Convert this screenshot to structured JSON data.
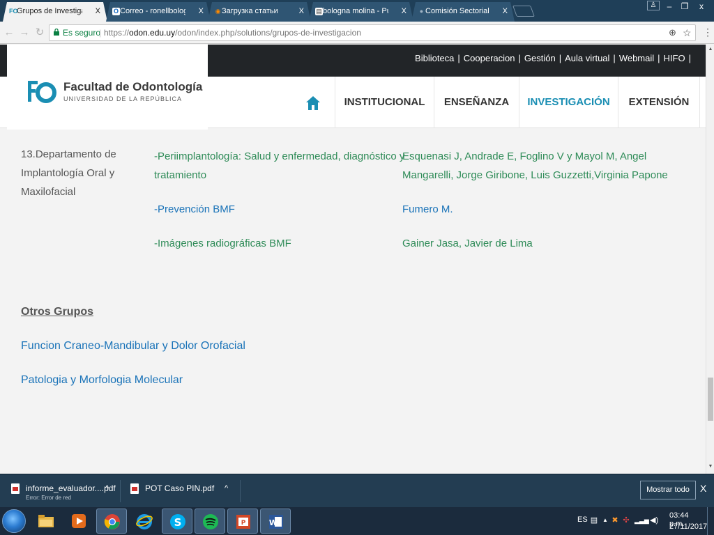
{
  "browser": {
    "tabs": [
      {
        "title": "Grupos de Investigación",
        "icon": "fo-favicon",
        "active": true
      },
      {
        "title": "Correo - ronellbologna@",
        "icon": "outlook-favicon",
        "active": false
      },
      {
        "title": "Загрузка статьи",
        "icon": "eye-favicon",
        "active": false
      },
      {
        "title": "bologna molina - PubMe",
        "icon": "document-favicon",
        "active": false
      },
      {
        "title": "Comisión Sectorial de In",
        "icon": "globe-favicon",
        "active": false
      }
    ],
    "window_controls": {
      "minimize": "–",
      "maximize": "❐",
      "close": "x"
    },
    "address": {
      "secure_label": "Es seguro",
      "url_scheme": "https://",
      "url_host": "odon.edu.uy",
      "url_path": "/odon/index.php/solutions/grupos-de-investigacion"
    }
  },
  "site": {
    "top_links": [
      "Biblioteca",
      "Cooperacion",
      "Gestión",
      "Aula virtual",
      "Webmail",
      "HIFO"
    ],
    "logo": {
      "mark": "FO",
      "name": "Facultad de Odontología",
      "subtitle": "UNIVERSIDAD DE LA REPÚBLICA"
    },
    "nav": [
      {
        "label": "INSTITUCIONAL",
        "active": false
      },
      {
        "label": "ENSEÑANZA",
        "active": false
      },
      {
        "label": "INVESTIGACIÓN",
        "active": true
      },
      {
        "label": "EXTENSIÓN",
        "active": false
      }
    ],
    "department": {
      "line1": "13.Departamento  de",
      "line2": "Implantología Oral y",
      "line3": "Maxilofacial"
    },
    "research_lines": [
      {
        "topic_line1": "-Periimplantología: Salud y enfermedad, diagnóstico y",
        "topic_line2": "tratamiento",
        "members_line1": "Esquenasi J, Andrade E, Foglino V y Mayol M,  Angel",
        "members_line2": "Mangarelli, Jorge Giribone, Luis Guzzetti,Virginia Papone"
      },
      {
        "topic_line1": "-Prevención BMF",
        "topic_line2": "",
        "members_line1": "Fumero M.",
        "members_line2": ""
      },
      {
        "topic_line1": "-Imágenes radiográficas BMF",
        "topic_line2": "",
        "members_line1": "Gainer Jasa, Javier de Lima",
        "members_line2": ""
      }
    ],
    "otros_title": "Otros Grupos ",
    "otros_links": [
      "Funcion Craneo-Mandibular y Dolor Orofacial",
      "Patologia y Morfologia Molecular"
    ]
  },
  "downloads": {
    "items": [
      {
        "name": "informe_evaluador....pdf",
        "status": "Error: Error de red"
      },
      {
        "name": "POT Caso PIN.pdf",
        "status": ""
      }
    ],
    "show_all": "Mostrar todo",
    "close": "X"
  },
  "taskbar": {
    "apps": [
      "file-explorer",
      "media-player",
      "chrome",
      "internet-explorer",
      "skype",
      "spotify",
      "powerpoint-viewer",
      "word"
    ],
    "language": "ES",
    "time": "03:44 p.m.",
    "date": "27/11/2017"
  },
  "colors": {
    "site_accent": "#1a8eb3",
    "topbar": "#222528",
    "green_text": "#2e8b57",
    "blue_text": "#1a73b8",
    "chrome_frame": "#1f3f58"
  }
}
